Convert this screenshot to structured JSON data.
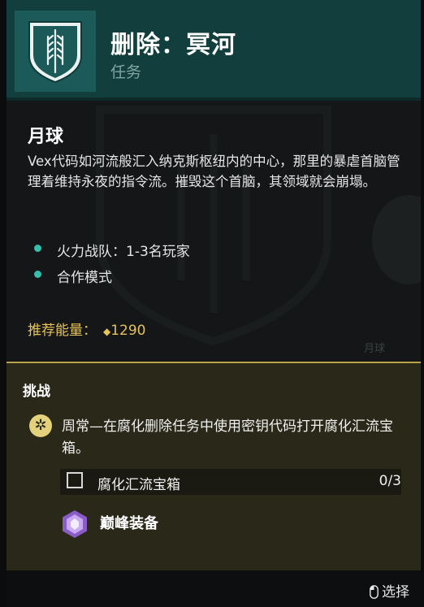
{
  "header": {
    "title": "删除：冥河",
    "subtitle": "任务",
    "emblem_icon": "vex-strike-emblem-icon"
  },
  "body": {
    "location": "月球",
    "background_location_label": "月球",
    "description": "Vex代码如河流般汇入纳克斯枢纽内的中心，那里的暴虐首脑管理着维持永夜的指令流。摧毁这个首脑，其领域就会崩塌。",
    "bullets": [
      "火力战队：1-3名玩家",
      "合作模式"
    ],
    "power_label": "推荐能量：",
    "power_value": "1290"
  },
  "challenge": {
    "section_title": "挑战",
    "description": "周常—在腐化删除任务中使用密钥代码打开腐化汇流宝箱。",
    "objective_label": "腐化汇流宝箱",
    "objective_progress": "0/3",
    "reward_label": "巅峰装备"
  },
  "footer": {
    "select_label": "选择"
  },
  "colors": {
    "header_bg": "#123f3e",
    "accent_teal": "#35c0ad",
    "power_gold": "#e6c35a",
    "challenge_bg": "#2a2819"
  }
}
